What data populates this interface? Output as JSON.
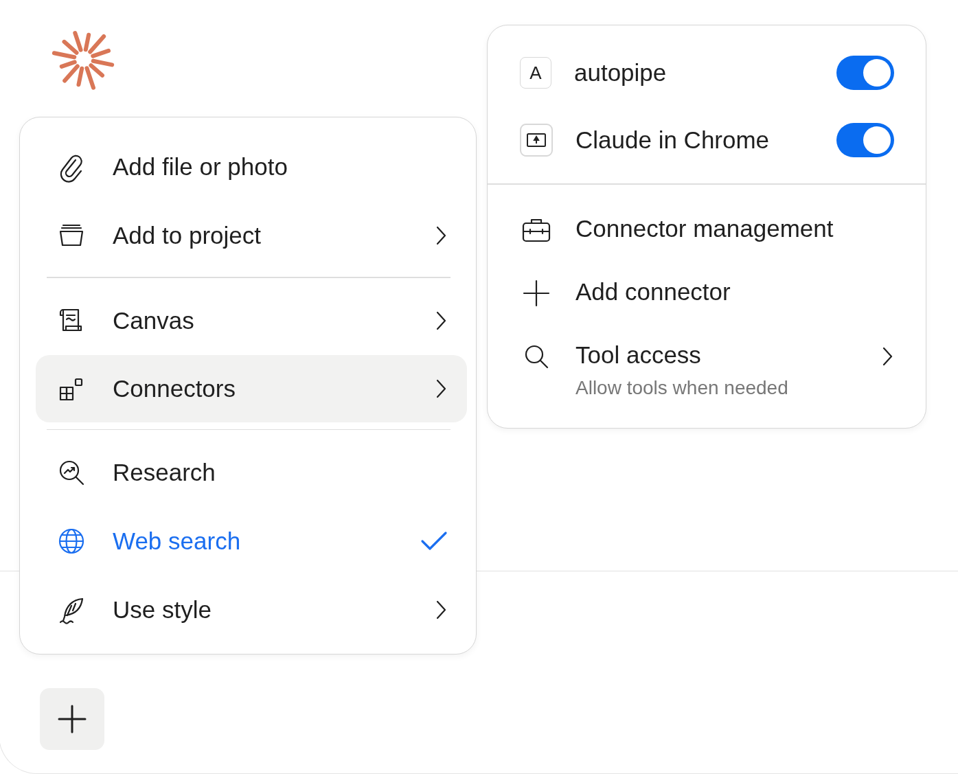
{
  "attach_menu": {
    "groups": [
      {
        "items": [
          {
            "label": "Add file or photo",
            "submenu": false,
            "selected": false,
            "checked": false
          },
          {
            "label": "Add to project",
            "submenu": true,
            "selected": false,
            "checked": false
          }
        ]
      },
      {
        "items": [
          {
            "label": "Canvas",
            "submenu": true,
            "selected": false,
            "checked": false
          },
          {
            "label": "Connectors",
            "submenu": true,
            "selected": true,
            "checked": false
          }
        ]
      },
      {
        "items": [
          {
            "label": "Research",
            "submenu": false,
            "selected": false,
            "checked": false
          },
          {
            "label": "Web search",
            "submenu": false,
            "selected": false,
            "checked": true
          },
          {
            "label": "Use style",
            "submenu": true,
            "selected": false,
            "checked": false
          }
        ]
      }
    ]
  },
  "connectors_menu": {
    "connectors": [
      {
        "label": "autopipe",
        "badge": "A",
        "on": true
      },
      {
        "label": "Claude in Chrome",
        "on": true
      }
    ],
    "actions": [
      {
        "label": "Connector management",
        "submenu": false
      },
      {
        "label": "Add connector",
        "submenu": false
      },
      {
        "label": "Tool access",
        "description": "Allow tools when needed",
        "submenu": true
      }
    ]
  }
}
